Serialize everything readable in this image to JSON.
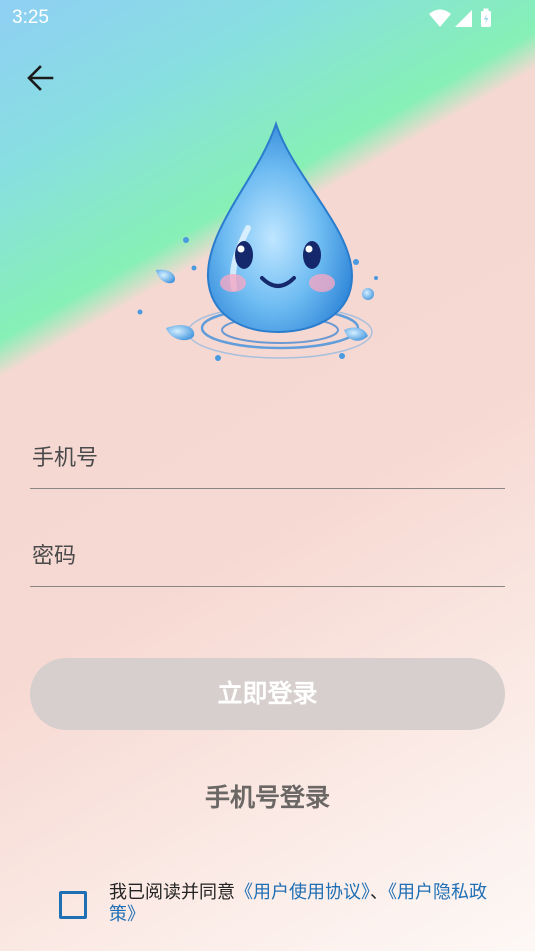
{
  "status_bar": {
    "time": "3:25",
    "icons": [
      "wifi-icon",
      "signal-icon",
      "battery-icon"
    ]
  },
  "nav": {
    "back_icon": "arrow-left-icon"
  },
  "mascot": {
    "description_icon": "water-drop-mascot"
  },
  "form": {
    "phone_placeholder": "手机号",
    "password_placeholder": "密码"
  },
  "actions": {
    "login_label": "立即登录",
    "phone_login_label": "手机号登录"
  },
  "agreement": {
    "prefix": "我已阅读并同意",
    "user_agreement": "《用户使用协议》",
    "separator": "、",
    "privacy_policy": "《用户隐私政策》"
  },
  "colors": {
    "accent": "#1f6fb5",
    "button_bg": "#d6cfcd",
    "button_text": "#ffffff",
    "secondary_text": "#6b6765"
  }
}
